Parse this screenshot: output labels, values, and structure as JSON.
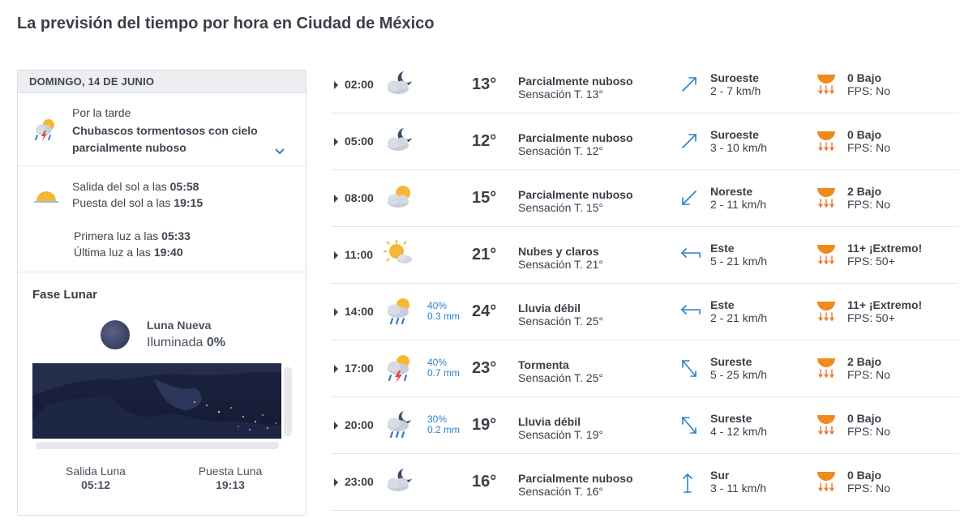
{
  "page_title": "La previsión del tiempo por hora en Ciudad de México",
  "day": {
    "header": "DOMINGO, 14 DE JUNIO",
    "afternoon": {
      "label": "Por la tarde",
      "description": "Chubascos tormentosos con cielo parcialmente nuboso",
      "icon": "storm-sun-icon"
    },
    "sun": {
      "sunrise_label": "Salida del sol a las ",
      "sunrise": "05:58",
      "sunset_label": "Puesta del sol a las ",
      "sunset": "19:15",
      "first_light_label": "Primera luz a las ",
      "first_light": "05:33",
      "last_light_label": "Última luz a las ",
      "last_light": "19:40"
    },
    "moon": {
      "title": "Fase Lunar",
      "phase": "Luna Nueva",
      "illuminated_label": "Iluminada ",
      "illuminated": "0%",
      "moonrise_label": "Salida Luna",
      "moonrise": "05:12",
      "moonset_label": "Puesta Luna",
      "moonset": "19:13"
    }
  },
  "hours": [
    {
      "time": "02:00",
      "icon": "moon-cloud-icon",
      "prob": "",
      "rain": "",
      "temp": "13°",
      "condition": "Parcialmente nuboso",
      "feels": "Sensación T. 13°",
      "wind_dir": "Suroeste",
      "wind_speed": "2  - 7 km/h",
      "wind_arrow": "arrow-northeast-icon",
      "uv": "0 Bajo",
      "fps": "FPS: No"
    },
    {
      "time": "05:00",
      "icon": "moon-cloud-icon",
      "prob": "",
      "rain": "",
      "temp": "12°",
      "condition": "Parcialmente nuboso",
      "feels": "Sensación T. 12°",
      "wind_dir": "Suroeste",
      "wind_speed": "3  - 10 km/h",
      "wind_arrow": "arrow-northeast-icon",
      "uv": "0 Bajo",
      "fps": "FPS: No"
    },
    {
      "time": "08:00",
      "icon": "sun-cloud-icon",
      "prob": "",
      "rain": "",
      "temp": "15°",
      "condition": "Parcialmente nuboso",
      "feels": "Sensación T. 15°",
      "wind_dir": "Noreste",
      "wind_speed": "2  - 11 km/h",
      "wind_arrow": "arrow-southwest-icon",
      "uv": "2 Bajo",
      "fps": "FPS: No"
    },
    {
      "time": "11:00",
      "icon": "sun-small-cloud-icon",
      "prob": "",
      "rain": "",
      "temp": "21°",
      "condition": "Nubes y claros",
      "feels": "Sensación T. 21°",
      "wind_dir": "Este",
      "wind_speed": "5  - 21 km/h",
      "wind_arrow": "arrow-west-icon",
      "uv": "11+ ¡Extremo!",
      "fps": "FPS: 50+"
    },
    {
      "time": "14:00",
      "icon": "rain-sun-icon",
      "prob": "40%",
      "rain": "0.3 mm",
      "temp": "24°",
      "condition": "Lluvia débil",
      "feels": "Sensación T. 25°",
      "wind_dir": "Este",
      "wind_speed": "2  - 21 km/h",
      "wind_arrow": "arrow-west-icon",
      "uv": "11+ ¡Extremo!",
      "fps": "FPS: 50+"
    },
    {
      "time": "17:00",
      "icon": "storm-sun-icon",
      "prob": "40%",
      "rain": "0.7 mm",
      "temp": "23°",
      "condition": "Tormenta",
      "feels": "Sensación T. 25°",
      "wind_dir": "Sureste",
      "wind_speed": "5  - 25 km/h",
      "wind_arrow": "arrow-northwest-icon",
      "uv": "2 Bajo",
      "fps": "FPS: No"
    },
    {
      "time": "20:00",
      "icon": "rain-moon-icon",
      "prob": "30%",
      "rain": "0.2 mm",
      "temp": "19°",
      "condition": "Lluvia débil",
      "feels": "Sensación T. 19°",
      "wind_dir": "Sureste",
      "wind_speed": "4  - 12 km/h",
      "wind_arrow": "arrow-northwest-icon",
      "uv": "0 Bajo",
      "fps": "FPS: No"
    },
    {
      "time": "23:00",
      "icon": "moon-cloud-icon",
      "prob": "",
      "rain": "",
      "temp": "16°",
      "condition": "Parcialmente nuboso",
      "feels": "Sensación T. 16°",
      "wind_dir": "Sur",
      "wind_speed": "3  - 11 km/h",
      "wind_arrow": "arrow-north-icon",
      "uv": "0 Bajo",
      "fps": "FPS: No"
    }
  ],
  "colors": {
    "accent_blue": "#2b82c9",
    "text": "#3a3f48",
    "uv_orange": "#f08a1c"
  }
}
